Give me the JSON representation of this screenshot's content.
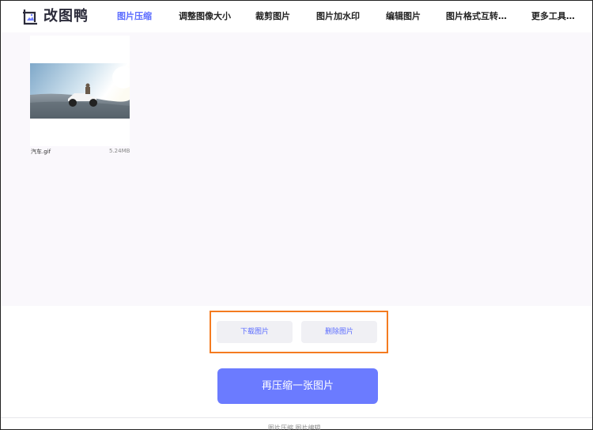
{
  "brand": {
    "name": "改图鸭",
    "icon": "image-frame-icon",
    "color": "#2b2b3a"
  },
  "nav": {
    "items": [
      {
        "label": "图片压缩",
        "active": true
      },
      {
        "label": "调整图像大小",
        "active": false
      },
      {
        "label": "裁剪图片",
        "active": false
      },
      {
        "label": "图片加水印",
        "active": false
      },
      {
        "label": "编辑图片",
        "active": false
      },
      {
        "label": "图片格式互转…",
        "active": false
      },
      {
        "label": "更多工具…",
        "active": false
      }
    ],
    "active_color": "#5b6cff"
  },
  "file": {
    "name": "汽车.gif",
    "size": "5.24MB"
  },
  "actions": {
    "download_label": "下载图片",
    "delete_label": "删除图片",
    "recompress_label": "再压缩一张图片"
  },
  "footer": {
    "text": "图片压缩  图片编辑"
  },
  "colors": {
    "accent": "#6b7bff",
    "highlight_border": "#f47b20",
    "workspace_bg": "#faf8fc"
  }
}
